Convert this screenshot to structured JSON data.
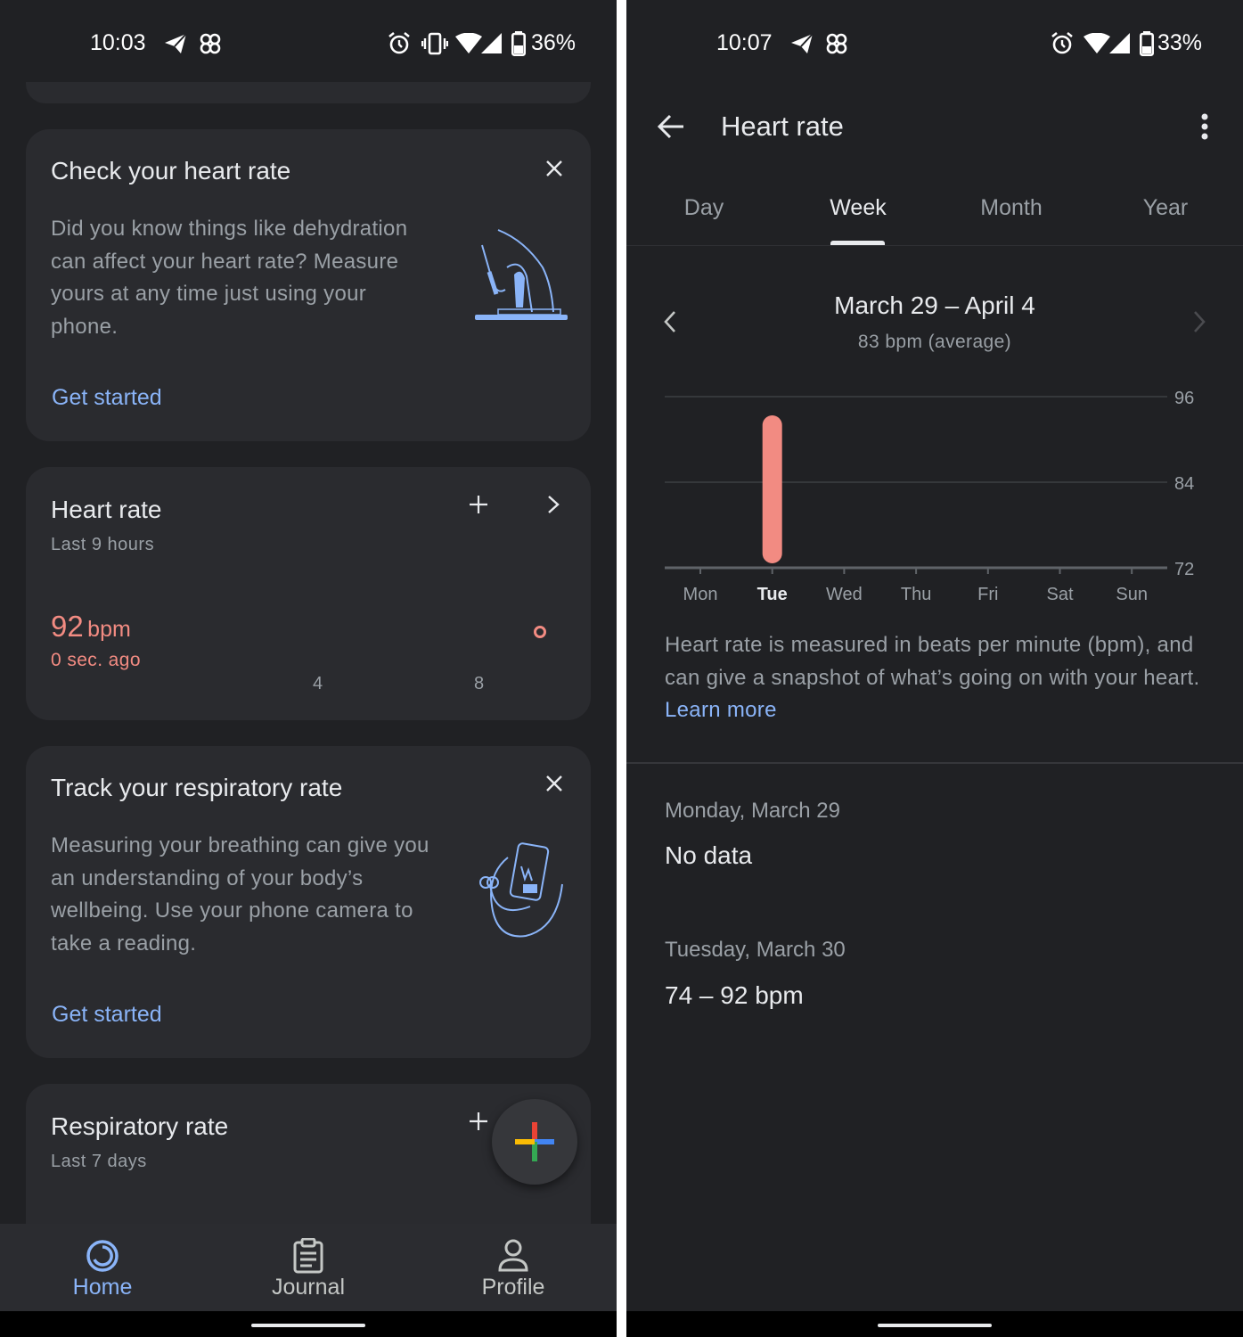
{
  "left": {
    "status": {
      "time": "10:03",
      "battery": "36%"
    },
    "check_card": {
      "title": "Check your heart rate",
      "body": "Did you know things like dehydration can affect your heart rate? Measure yours at any time just using your phone.",
      "action": "Get started"
    },
    "heart_card": {
      "title": "Heart rate",
      "subtitle": "Last 9 hours",
      "value": "92",
      "unit": "bpm",
      "ago": "0 sec. ago",
      "axis": [
        "4",
        "8"
      ]
    },
    "resp_track_card": {
      "title": "Track your respiratory rate",
      "body": "Measuring your breathing can give you an understanding of your body’s wellbeing. Use your phone camera to take a reading.",
      "action": "Get started"
    },
    "resp_card": {
      "title": "Respiratory rate",
      "subtitle": "Last 7 days"
    },
    "nav": [
      {
        "label": "Home",
        "icon": "home-ring-icon",
        "active": true
      },
      {
        "label": "Journal",
        "icon": "clipboard-icon",
        "active": false
      },
      {
        "label": "Profile",
        "icon": "person-icon",
        "active": false
      }
    ]
  },
  "right": {
    "status": {
      "time": "10:07",
      "battery": "33%"
    },
    "title": "Heart rate",
    "tabs": [
      "Day",
      "Week",
      "Month",
      "Year"
    ],
    "active_tab": "Week",
    "range": "March 29 – April 4",
    "average": "83 bpm (average)",
    "description": "Heart rate is measured in beats per minute (bpm), and can give a snapshot of what’s going on with your heart.",
    "learn_more": "Learn more",
    "entries": [
      {
        "date": "Monday, March 29",
        "value": "No data"
      },
      {
        "date": "Tuesday, March 30",
        "value": "74 – 92 bpm"
      }
    ]
  },
  "chart_data": {
    "type": "bar",
    "categories": [
      "Mon",
      "Tue",
      "Wed",
      "Thu",
      "Fri",
      "Sat",
      "Sun"
    ],
    "ranges": [
      null,
      [
        74,
        92
      ],
      null,
      null,
      null,
      null,
      null
    ],
    "yticks": [
      72,
      84,
      96
    ],
    "ylim": [
      72,
      96
    ],
    "highlighted_category": "Tue",
    "bar_color": "#f28b82",
    "grid": true
  },
  "colors": {
    "accent": "#8ab4f8",
    "heart": "#f28b82",
    "background": "#202124",
    "card": "#2a2b2f"
  }
}
